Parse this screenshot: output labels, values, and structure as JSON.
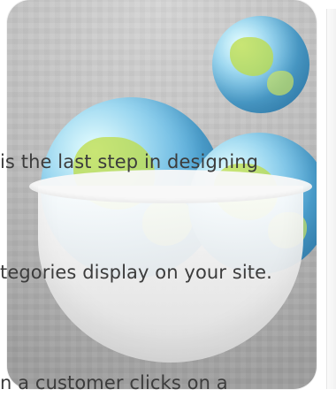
{
  "content": {
    "line_1": "is the last step in designing",
    "line_2": "tegories display on your site.",
    "line_3": "n a customer clicks on a"
  }
}
